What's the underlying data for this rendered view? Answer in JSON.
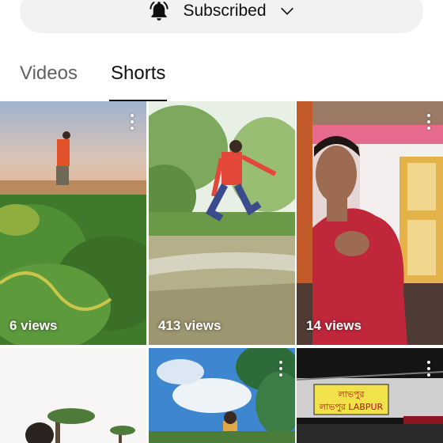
{
  "subscribe": {
    "label": "Subscribed",
    "bell_icon": "bell-icon",
    "chevron_icon": "chevron-down-icon"
  },
  "tabs": [
    {
      "label": "Videos",
      "active": false
    },
    {
      "label": "Shorts",
      "active": true
    }
  ],
  "shorts": [
    {
      "views": "6 views"
    },
    {
      "views": "413 views"
    },
    {
      "views": "14 views"
    },
    {
      "views": ""
    },
    {
      "views": ""
    },
    {
      "views": ""
    }
  ],
  "sign": {
    "line1": "লাভপুর",
    "line2": "লাভপুর LABPUR"
  },
  "colors": {
    "active_tab": "#0f0f0f",
    "inactive_tab": "#606060",
    "subscribe_bg": "#f2f2f2"
  }
}
